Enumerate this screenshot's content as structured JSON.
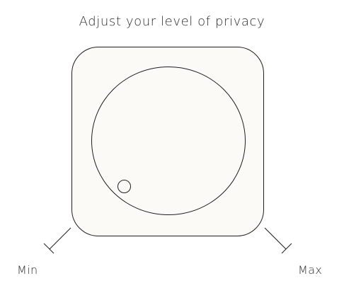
{
  "title": "Adjust your level of privacy",
  "dial": {
    "min_label": "Min",
    "max_label": "Max",
    "level": 0
  },
  "colors": {
    "stroke": "#1f1f1f",
    "device_fill": "#fbfaf6",
    "text": "#2b2b2b"
  }
}
